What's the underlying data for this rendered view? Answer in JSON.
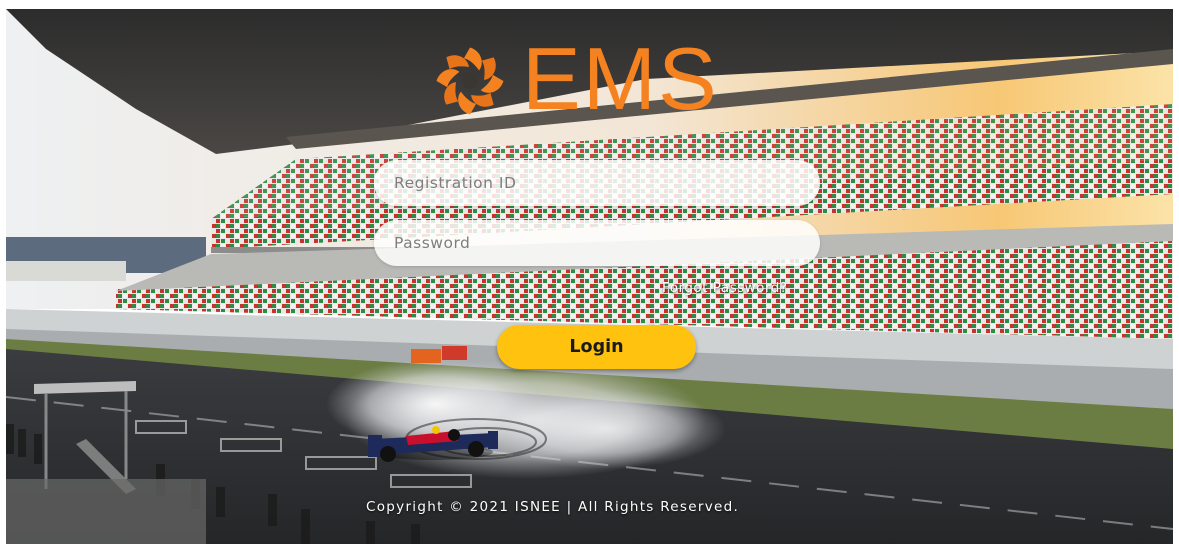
{
  "brand": {
    "logo_icon": "swirl-petal-logo-icon",
    "name": "EMS",
    "color": "#F58220"
  },
  "form": {
    "registration_placeholder": "Registration ID",
    "password_placeholder": "Password",
    "forgot_label": "Forgot Password?",
    "login_label": "Login",
    "login_color": "#FFC20E"
  },
  "footer": {
    "copyright": "Copyright © 2021 ISNEE | All Rights Reserved."
  },
  "background": {
    "scene": "race-circuit-grandstand-photo"
  }
}
